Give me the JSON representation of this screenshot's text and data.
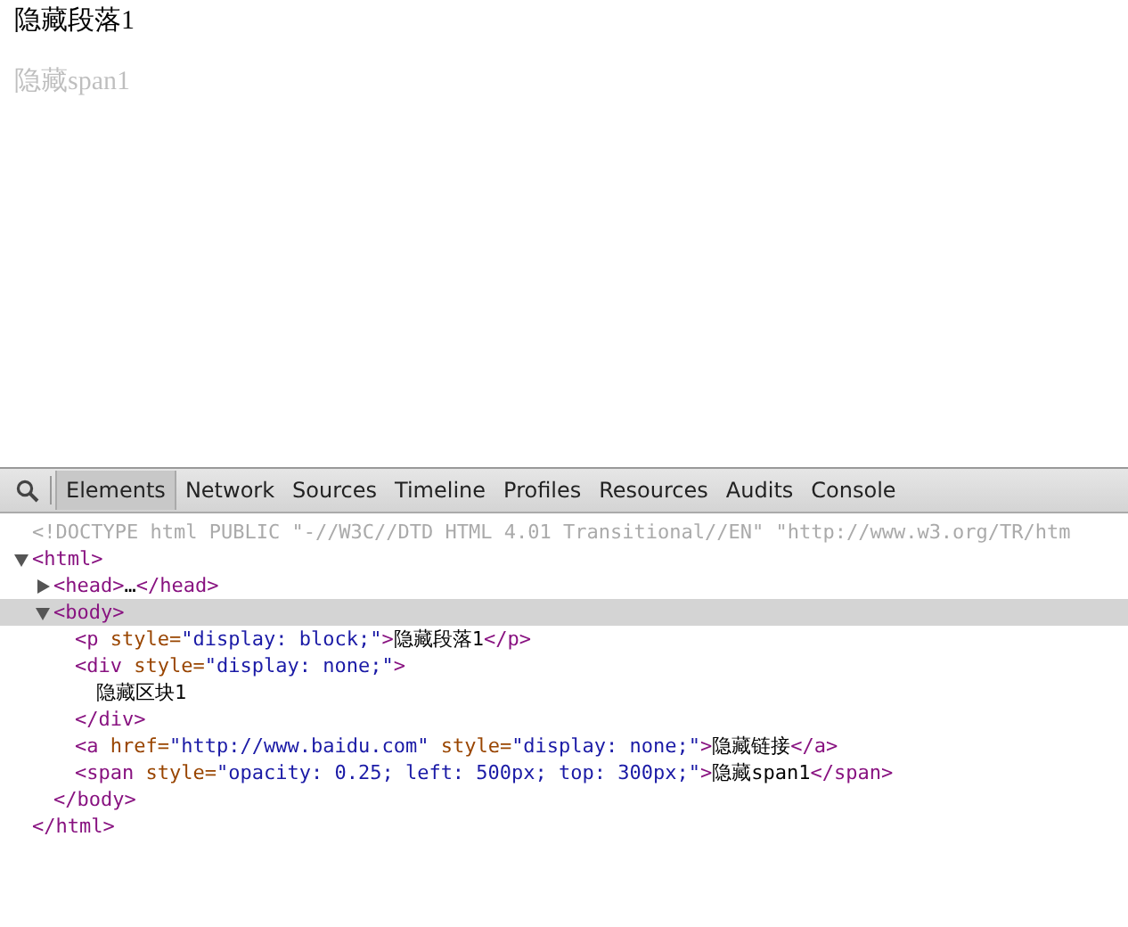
{
  "page": {
    "paragraph": "隐藏段落1",
    "span": "隐藏span1"
  },
  "devtools": {
    "tabs": [
      {
        "label": "Elements",
        "selected": true
      },
      {
        "label": "Network",
        "selected": false
      },
      {
        "label": "Sources",
        "selected": false
      },
      {
        "label": "Timeline",
        "selected": false
      },
      {
        "label": "Profiles",
        "selected": false
      },
      {
        "label": "Resources",
        "selected": false
      },
      {
        "label": "Audits",
        "selected": false
      },
      {
        "label": "Console",
        "selected": false
      }
    ],
    "dom_tree": [
      {
        "selected": false,
        "open": [
          {
            "kind": "doctype",
            "text": "<!DOCTYPE html PUBLIC \"-//W3C//DTD HTML 4.01 Transitional//EN\" \"http://www.w3.org/TR/htm"
          }
        ]
      },
      {
        "selected": false,
        "expanded": true,
        "open": [
          {
            "kind": "tag",
            "text": "<html>"
          }
        ],
        "close": [
          {
            "kind": "tag",
            "text": "</html>"
          }
        ],
        "children": [
          {
            "selected": false,
            "expanded": false,
            "open": [
              {
                "kind": "tag",
                "text": "<head>"
              },
              {
                "kind": "text",
                "text": "…"
              },
              {
                "kind": "tag",
                "text": "</head>"
              }
            ]
          },
          {
            "selected": true,
            "expanded": true,
            "open": [
              {
                "kind": "tag",
                "text": "<body>"
              }
            ],
            "close": [
              {
                "kind": "tag",
                "text": "</body>"
              }
            ],
            "children": [
              {
                "selected": false,
                "open": [
                  {
                    "kind": "tag",
                    "text": "<p"
                  },
                  {
                    "kind": "attr",
                    "text": " style="
                  },
                  {
                    "kind": "value",
                    "text": "\"display: block;\""
                  },
                  {
                    "kind": "tag",
                    "text": ">"
                  },
                  {
                    "kind": "text",
                    "text": "隐藏段落1"
                  },
                  {
                    "kind": "tag",
                    "text": "</p>"
                  }
                ]
              },
              {
                "selected": false,
                "open": [
                  {
                    "kind": "tag",
                    "text": "<div"
                  },
                  {
                    "kind": "attr",
                    "text": " style="
                  },
                  {
                    "kind": "value",
                    "text": "\"display: none;\""
                  },
                  {
                    "kind": "tag",
                    "text": ">"
                  }
                ],
                "close": [
                  {
                    "kind": "tag",
                    "text": "</div>"
                  }
                ],
                "children": [
                  {
                    "selected": false,
                    "open": [
                      {
                        "kind": "text",
                        "text": "隐藏区块1"
                      }
                    ]
                  }
                ]
              },
              {
                "selected": false,
                "open": [
                  {
                    "kind": "tag",
                    "text": "<a"
                  },
                  {
                    "kind": "attr",
                    "text": " href="
                  },
                  {
                    "kind": "value",
                    "text": "\"http://www.baidu.com\""
                  },
                  {
                    "kind": "attr",
                    "text": " style="
                  },
                  {
                    "kind": "value",
                    "text": "\"display: none;\""
                  },
                  {
                    "kind": "tag",
                    "text": ">"
                  },
                  {
                    "kind": "text",
                    "text": "隐藏链接"
                  },
                  {
                    "kind": "tag",
                    "text": "</a>"
                  }
                ]
              },
              {
                "selected": false,
                "open": [
                  {
                    "kind": "tag",
                    "text": "<span"
                  },
                  {
                    "kind": "attr",
                    "text": " style="
                  },
                  {
                    "kind": "value",
                    "text": "\"opacity: 0.25; left: 500px; top: 300px;\""
                  },
                  {
                    "kind": "tag",
                    "text": ">"
                  },
                  {
                    "kind": "text",
                    "text": "隐藏span1"
                  },
                  {
                    "kind": "tag",
                    "text": "</span>"
                  }
                ]
              }
            ]
          }
        ]
      }
    ]
  }
}
